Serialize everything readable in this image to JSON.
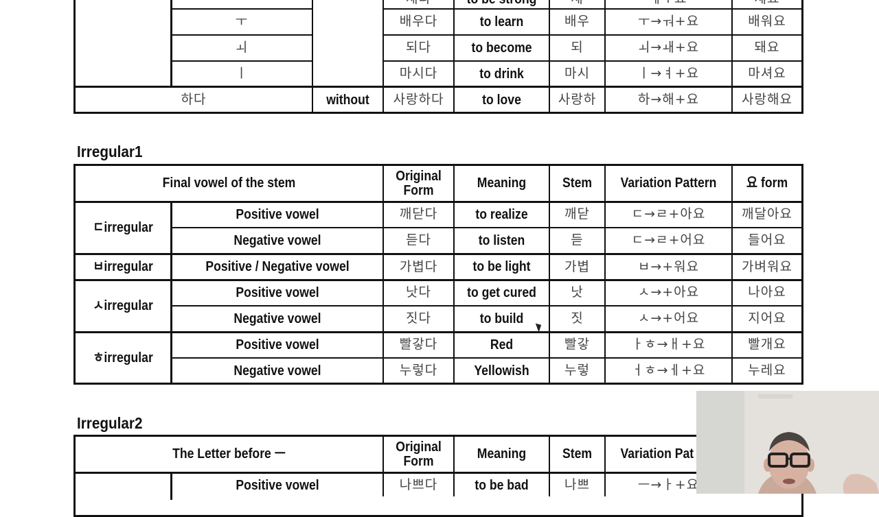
{
  "top_table": {
    "partial_row": {
      "original": "세다",
      "meaning": "to be strong",
      "stem": "세",
      "pattern": "ㅔ+요",
      "yo_form": "세요"
    },
    "vowel_rows": [
      {
        "vowel": "ㅜ",
        "original": "배우다",
        "meaning": "to learn",
        "stem": "배우",
        "pattern": "ㅜ→ㅝ+요",
        "yo_form": "배워요"
      },
      {
        "vowel": "ㅚ",
        "original": "되다",
        "meaning": "to become",
        "stem": "되",
        "pattern": "ㅚ→ㅙ+요",
        "yo_form": "돼요"
      },
      {
        "vowel": "ㅣ",
        "original": "마시다",
        "meaning": "to drink",
        "stem": "마시",
        "pattern": "ㅣ→ㅕ+요",
        "yo_form": "마셔요"
      }
    ],
    "hada_row": {
      "label": "하다",
      "batchim": "without",
      "original": "사랑하다",
      "meaning": "to love",
      "stem": "사랑하",
      "pattern": "하→해+요",
      "yo_form": "사랑해요"
    }
  },
  "irregular1": {
    "title": "Irregular1",
    "headers": {
      "group": "Final vowel of the stem",
      "original": "Original Form",
      "meaning": "Meaning",
      "stem": "Stem",
      "pattern": "Variation Pattern",
      "yo_form": "요 form"
    },
    "groups": [
      {
        "name": "ㄷirregular",
        "rows": [
          {
            "vowel": "Positive vowel",
            "original": "깨닫다",
            "meaning": "to realize",
            "stem": "깨닫",
            "pattern": "ㄷ→ㄹ+아요",
            "yo_form": "깨달아요"
          },
          {
            "vowel": "Negative vowel",
            "original": "듣다",
            "meaning": "to listen",
            "stem": "듣",
            "pattern": "ㄷ→ㄹ+어요",
            "yo_form": "들어요"
          }
        ]
      },
      {
        "name": "ㅂirregular",
        "rows": [
          {
            "vowel": "Positive / Negative vowel",
            "original": "가볍다",
            "meaning": "to be light",
            "stem": "가볍",
            "pattern": "ㅂ→+워요",
            "yo_form": "가벼워요"
          }
        ]
      },
      {
        "name": "ㅅirregular",
        "rows": [
          {
            "vowel": "Positive vowel",
            "original": "낫다",
            "meaning": "to get cured",
            "stem": "낫",
            "pattern": "ㅅ→+아요",
            "yo_form": "나아요"
          },
          {
            "vowel": "Negative vowel",
            "original": "짓다",
            "meaning": "to build",
            "stem": "짓",
            "pattern": "ㅅ→+어요",
            "yo_form": "지어요"
          }
        ]
      },
      {
        "name": "ㅎirregular",
        "rows": [
          {
            "vowel": "Positive vowel",
            "original": "빨갛다",
            "meaning": "Red",
            "stem": "빨갛",
            "pattern": "ㅏㅎ→ㅐ+요",
            "yo_form": "빨개요"
          },
          {
            "vowel": "Negative vowel",
            "original": "누렇다",
            "meaning": "Yellowish",
            "stem": "누렇",
            "pattern": "ㅓㅎ→ㅔ+요",
            "yo_form": "누레요"
          }
        ]
      }
    ]
  },
  "irregular2": {
    "title": "Irregular2",
    "headers": {
      "group": "The Letter before ㅡ",
      "original": "Original Form",
      "meaning": "Meaning",
      "stem": "Stem",
      "pattern": "Variation Pat"
    },
    "rows": [
      {
        "vowel": "Positive vowel",
        "original": "나쁘다",
        "meaning": "to be bad",
        "stem": "나쁘",
        "pattern": "ㅡ→ㅏ+요"
      }
    ]
  },
  "webcam": {
    "label": "presenter-video"
  }
}
